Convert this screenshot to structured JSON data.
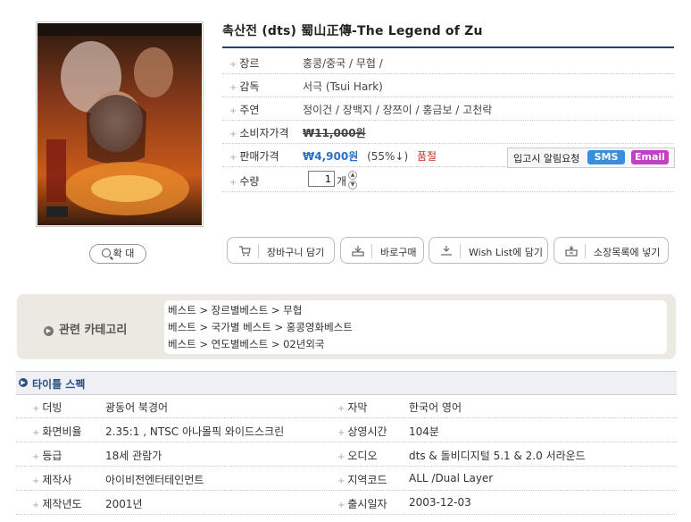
{
  "product": {
    "title": "촉산전 (dts) 蜀山正傳-The Legend of Zu",
    "zoom_label": "확 대",
    "info": [
      {
        "label": "장르",
        "value": "홍콩/중국 / 무협 /"
      },
      {
        "label": "감독",
        "value": "서극 (Tsui Hark)"
      },
      {
        "label": "주연",
        "value": "정이건 / 장백지 / 장쯔이 / 홍금보 / 고천락"
      },
      {
        "label": "소비자가격",
        "value": "₩11,000원"
      },
      {
        "label": "판매가격",
        "price": "₩4,900원",
        "discount": "(55%↓)",
        "status": "품절"
      },
      {
        "label": "수량",
        "quantity": "1",
        "unit": "개"
      }
    ],
    "restock": {
      "label": "입고시 알림요청",
      "sms": "SMS",
      "email": "Email"
    },
    "actions": [
      {
        "label": "장바구니 담기",
        "icon": "cart-icon"
      },
      {
        "label": "바로구매",
        "icon": "buy-icon"
      },
      {
        "label": "Wish List에 담기",
        "icon": "wishlist-icon"
      },
      {
        "label": "소장목록에 넣기",
        "icon": "collection-icon"
      }
    ]
  },
  "related": {
    "label": "관련 카테고리",
    "paths": [
      "베스트 > 장르별베스트 > 무협",
      "베스트 > 국가별 베스트 > 홍콩영화베스트",
      "베스트 > 연도별베스트 > 02년외국"
    ]
  },
  "spec": {
    "title": "타이틀 스펙",
    "rows": [
      {
        "l_label": "더빙",
        "l_value": "광동어 북경어",
        "r_label": "자막",
        "r_value": "한국어 영어"
      },
      {
        "l_label": "화면비율",
        "l_value": "2.35:1 , NTSC 아나몰픽 와이드스크린",
        "r_label": "상영시간",
        "r_value": "104분"
      },
      {
        "l_label": "등급",
        "l_value": "18세 관람가",
        "r_label": "오디오",
        "r_value": "dts & 돌비디지털 5.1 & 2.0 서라운드"
      },
      {
        "l_label": "제작사",
        "l_value": "아이비전엔터테인먼트",
        "r_label": "지역코드",
        "r_value": "ALL /Dual Layer"
      },
      {
        "l_label": "제작년도",
        "l_value": "2001년",
        "r_label": "출시일자",
        "r_value": "2003-12-03"
      }
    ]
  }
}
